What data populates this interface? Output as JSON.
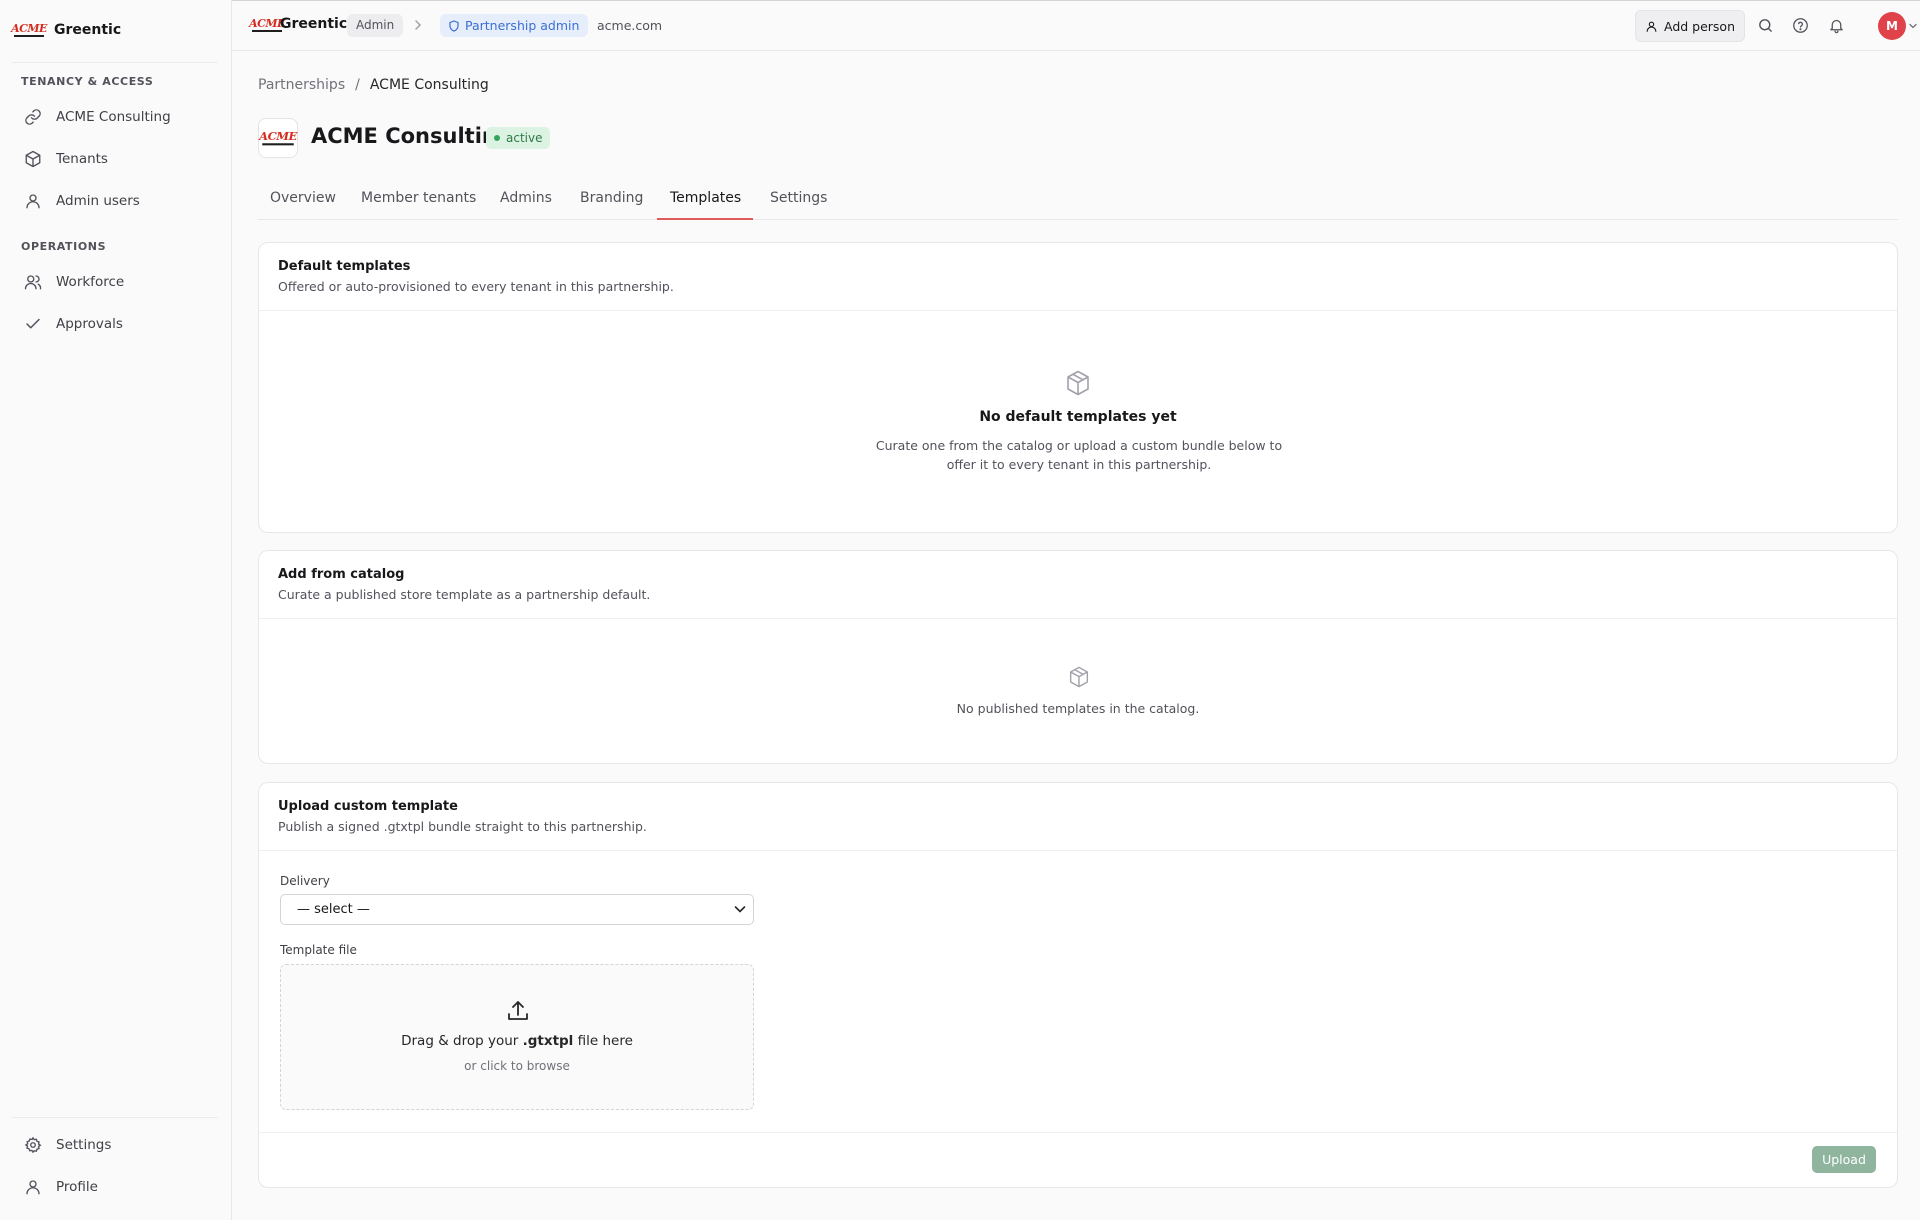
{
  "brand": {
    "name": "Greentic",
    "logo_text": "ACME"
  },
  "sidebar": {
    "sections": [
      {
        "title": "TENANCY & ACCESS"
      },
      {
        "title": "OPERATIONS"
      }
    ],
    "items": [
      {
        "label": "ACME Consulting",
        "icon": "link-icon"
      },
      {
        "label": "Tenants",
        "icon": "box-icon"
      },
      {
        "label": "Admin users",
        "icon": "user-icon"
      },
      {
        "label": "Workforce",
        "icon": "users-icon"
      },
      {
        "label": "Approvals",
        "icon": "check-icon"
      }
    ],
    "footer": [
      {
        "label": "Settings",
        "icon": "gear-icon"
      },
      {
        "label": "Profile",
        "icon": "user-icon"
      }
    ]
  },
  "topbar": {
    "brand": "Greentic",
    "role_badge": "Admin",
    "context_badge": "Partnership admin",
    "domain": "acme.com",
    "add_person": "Add person",
    "avatar_initial": "M"
  },
  "breadcrumb": {
    "parent": "Partnerships",
    "separator": "/",
    "current": "ACME Consulting"
  },
  "page": {
    "title": "ACME Consulting",
    "status": "active",
    "status_color": "#33a55a"
  },
  "tabs": [
    {
      "label": "Overview"
    },
    {
      "label": "Member tenants"
    },
    {
      "label": "Admins"
    },
    {
      "label": "Branding"
    },
    {
      "label": "Templates",
      "active": true
    },
    {
      "label": "Settings"
    }
  ],
  "default_templates": {
    "title": "Default templates",
    "subtitle": "Offered or auto-provisioned to every tenant in this partnership.",
    "empty_title": "No default templates yet",
    "empty_desc": "Curate one from the catalog or upload a custom bundle below to offer it to every tenant in this partnership."
  },
  "catalog": {
    "title": "Add from catalog",
    "subtitle": "Curate a published store template as a partnership default.",
    "empty_line": "No published templates in the catalog."
  },
  "upload": {
    "title": "Upload custom template",
    "subtitle": "Publish a signed .gtxtpl bundle straight to this partnership.",
    "delivery_label": "Delivery",
    "delivery_value": "— select —",
    "file_label": "Template file",
    "drop_prefix": "Drag & drop your ",
    "drop_ext": ".gtxtpl",
    "drop_suffix": " file here",
    "drop_sub": "or click to browse",
    "button": "Upload",
    "button_color": "#8fb59f"
  }
}
